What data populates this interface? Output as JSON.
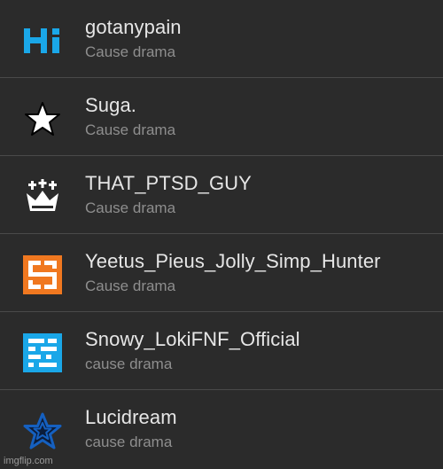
{
  "rows": [
    {
      "name": "gotanypain",
      "subtitle": "Cause drama",
      "icon": "hi-logo-icon"
    },
    {
      "name": "Suga.",
      "subtitle": "Cause drama",
      "icon": "star-icon"
    },
    {
      "name": "THAT_PTSD_GUY",
      "subtitle": "Cause drama",
      "icon": "crown-icon"
    },
    {
      "name": "Yeetus_Pieus_Jolly_Simp_Hunter",
      "subtitle": "Cause drama",
      "icon": "swirl-glyph-icon"
    },
    {
      "name": "Snowy_LokiFNF_Official",
      "subtitle": "cause drama",
      "icon": "pixel-block-icon"
    },
    {
      "name": "Lucidream",
      "subtitle": "cause drama",
      "icon": "star-outline-icon"
    }
  ],
  "colors": {
    "background": "#2b2b2b",
    "divider": "#4a4a4a",
    "name_text": "#e6e6e6",
    "subtitle_text": "#8e8e8e",
    "hi_blue": "#1aa7e8",
    "orange": "#f07820",
    "cyan": "#1aa7e8",
    "lucid_blue": "#1560c0"
  },
  "watermark": "imgflip.com"
}
